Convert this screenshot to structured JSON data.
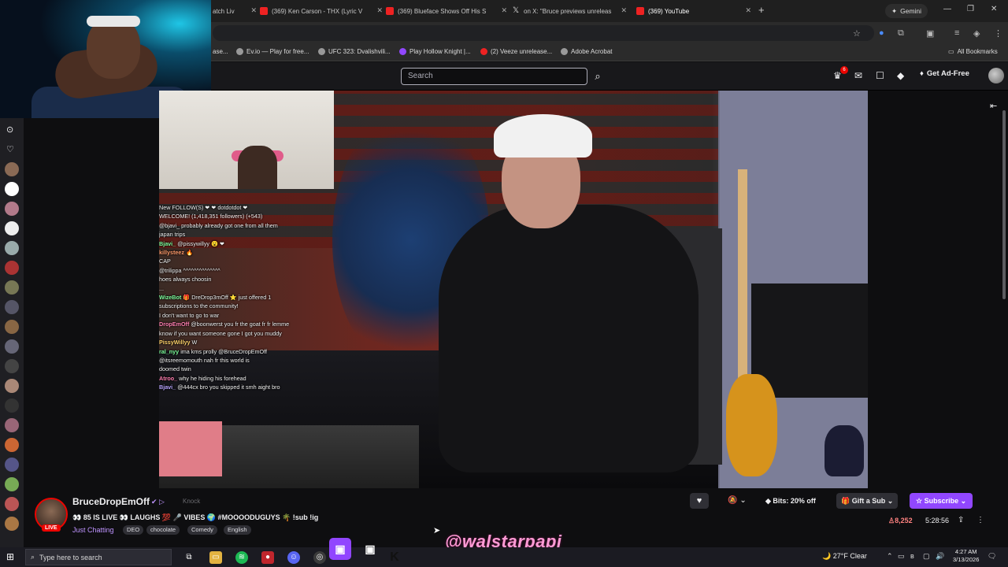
{
  "browser": {
    "tabs": [
      {
        "title": "atch Liv",
        "icon": "youtube-icon"
      },
      {
        "title": "(369) Ken Carson - THX (Lyric V",
        "icon": "youtube-icon"
      },
      {
        "title": "(369) Blueface Shows Off His S",
        "icon": "youtube-icon"
      },
      {
        "title": "on X: \"Bruce previews unreleas",
        "icon": "x-icon"
      },
      {
        "title": "(369) YouTube",
        "icon": "youtube-icon"
      }
    ],
    "gemini_label": "Gemini",
    "bookmarks": [
      {
        "label": "ase..."
      },
      {
        "label": "Ev.io — Play for free..."
      },
      {
        "label": "UFC 323: Dvalishvili..."
      },
      {
        "label": "Play Hollow Knight |..."
      },
      {
        "label": "(2) Veeze unrelease..."
      },
      {
        "label": "Adobe Acrobat"
      }
    ],
    "all_bookmarks": "All Bookmarks"
  },
  "twitch_nav": {
    "search_placeholder": "Search",
    "notifications_count": "6",
    "get_ad_free": "Get Ad-Free"
  },
  "chat": [
    {
      "user": "",
      "text": "New FOLLOW(S) ❤ ❤ dotdotdot ❤"
    },
    {
      "user": "",
      "text": "WELCOME! (1,418,351 followers) (+543)"
    },
    {
      "user": "",
      "text": "@bjavi_ probably already got one from all them"
    },
    {
      "user": "",
      "text": "japan trips"
    },
    {
      "user": "Bjavi_",
      "text": "@pissywillyy 😮 ❤"
    },
    {
      "user": "killysteez",
      "text": "🔥"
    },
    {
      "user": "",
      "text": "CAP"
    },
    {
      "user": "",
      "text": "@trilippa ^^^^^^^^^^^^^^"
    },
    {
      "user": "",
      "text": "hoes always choosin"
    },
    {
      "user": "",
      "text": "..."
    },
    {
      "user": "WizeBot",
      "text": "🎁 DreDrop3mOff ⭐ just offered 1"
    },
    {
      "user": "",
      "text": "subscriptions to the community!"
    },
    {
      "user": "",
      "text": "I don't want to go to war"
    },
    {
      "user": "DropEmOff",
      "text": "@boonwerst you fr the goat fr fr lemme"
    },
    {
      "user": "",
      "text": "know if you want someone gone I got you muddy"
    },
    {
      "user": "PissyWillyy",
      "text": "W"
    },
    {
      "user": "ral_nyy",
      "text": "ima kms prolly @BruceDropEmOff"
    },
    {
      "user": "",
      "text": "@itsreemomouth nah fr this world is"
    },
    {
      "user": "",
      "text": "doomed twin"
    },
    {
      "user": "Atroo_",
      "text": "why he hiding his forehead"
    },
    {
      "user": "Bjavi_",
      "text": "@444cx bro you skipped it smh aight bro"
    }
  ],
  "channel": {
    "name": "BruceDropEmOff",
    "knock": "Knock",
    "live_label": "LIVE",
    "stream_title": "👀 85 IS LIVE 👀 LAUGHS 💯 🎤 VIBES 🌍 #MOOOODUGUYS 🌴 !sub !ig",
    "category": "Just Chatting",
    "tags": [
      "DEO",
      "chocolate",
      "Comedy",
      "English"
    ],
    "viewers": "8,252",
    "uptime": "5:28:56"
  },
  "actions": {
    "bits_label": "Bits: 20% off",
    "gift_label": "Gift a Sub",
    "subscribe_label": "Subscribe"
  },
  "watermark": "@walstarpapi",
  "taskbar": {
    "search_placeholder": "Type here to search",
    "weather": "27°F  Clear",
    "time": "4:27 AM",
    "date": "3/13/2026"
  }
}
